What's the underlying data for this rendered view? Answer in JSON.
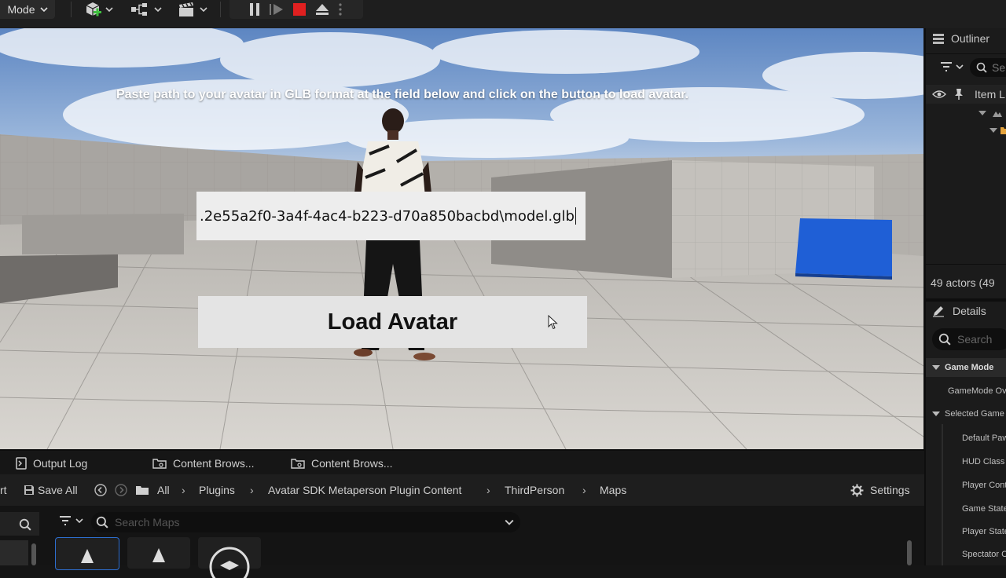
{
  "toolbar": {
    "mode_label": "Mode"
  },
  "viewport": {
    "instruction": "Paste path to your avatar in GLB format at the field below and click on the button to load avatar.",
    "path_value": ".2e55a2f0-3a4f-4ac4-b223-d70a850bacbd\\model.glb",
    "load_button_label": "Load Avatar"
  },
  "outliner": {
    "title": "Outliner",
    "search_placeholder": "Se",
    "column_label": "Item L",
    "actor_count": "49 actors (49"
  },
  "details": {
    "title": "Details",
    "search_placeholder": "Search",
    "sections": {
      "game_mode": "Game Mode",
      "gamemode_override": "GameMode Ove",
      "selected_game": "Selected Game"
    },
    "rows": [
      "Default Paw",
      "HUD Class",
      "Player Cont",
      "Game State",
      "Player State",
      "Spectator C"
    ]
  },
  "bottom_tabs": {
    "output_log": "Output Log",
    "content_browser_1": "Content Brows...",
    "content_browser_2": "Content Brows..."
  },
  "path_bar": {
    "left_fragment": "rt",
    "save_all": "Save All",
    "crumbs": [
      "All",
      "Plugins",
      "Avatar SDK Metaperson Plugin Content",
      "ThirdPerson",
      "Maps"
    ],
    "settings": "Settings"
  },
  "asset_browser": {
    "search_placeholder": "Search Maps"
  },
  "colors": {
    "accent_orange": "#e5a33b",
    "stop_red": "#e02020",
    "cube_blue": "#1f5fd6"
  }
}
